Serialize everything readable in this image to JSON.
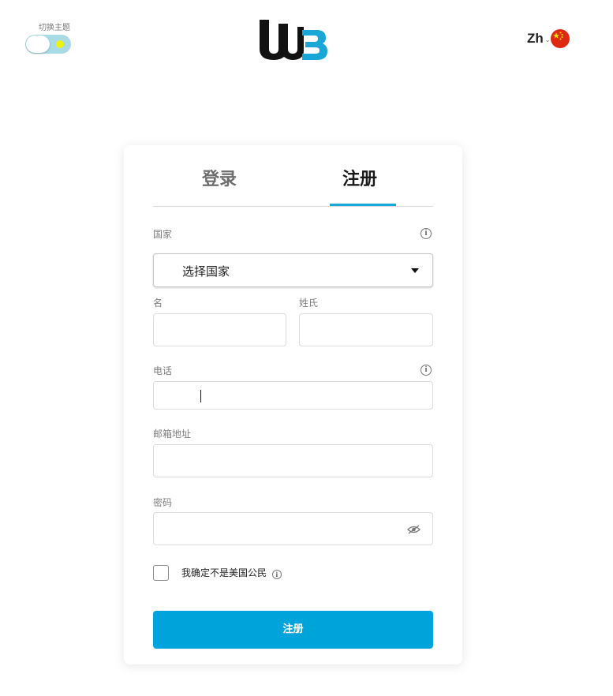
{
  "header": {
    "theme_toggle_label": "切换主题",
    "logo_text": "WB",
    "language_code": "Zh",
    "language_chevron": "⌄",
    "flag": "china-flag"
  },
  "tabs": {
    "login": "登录",
    "register": "注册",
    "active": "register"
  },
  "form": {
    "country_label": "国家",
    "country_placeholder": "选择国家",
    "first_name_label": "名",
    "last_name_label": "姓氏",
    "phone_label": "电话",
    "email_label": "邮箱地址",
    "password_label": "密码",
    "checkbox_label": "我确定不是美国公民",
    "info_symbol": "i",
    "submit_label": "注册"
  },
  "colors": {
    "accent": "#00a4db",
    "tab_underline": "#18a7d6",
    "toggle_track": "#a9dbe6",
    "sun": "#eef20f",
    "flag_red": "#de2910"
  }
}
